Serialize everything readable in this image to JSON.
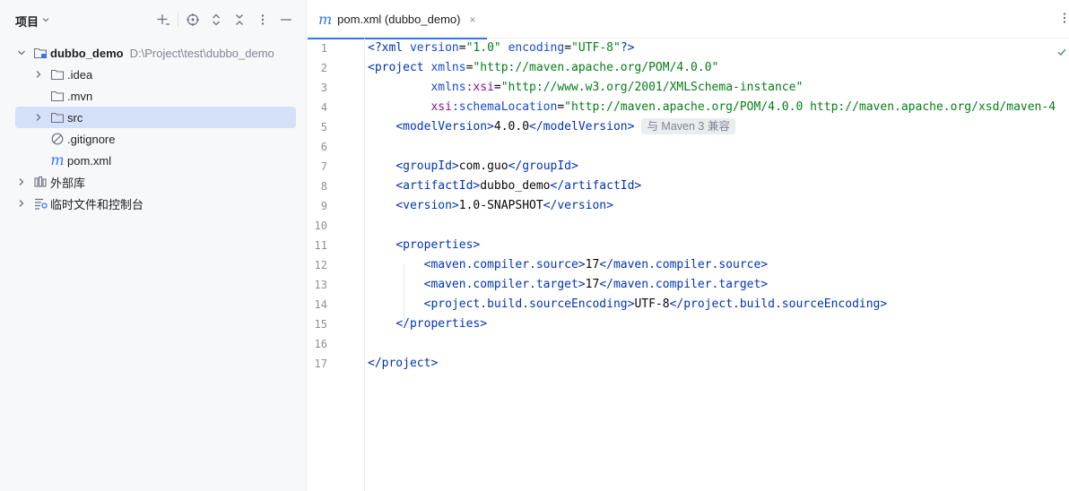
{
  "project_panel": {
    "title": "项目",
    "tools": [
      "add-icon",
      "locate-icon",
      "expand-all-icon",
      "collapse-all-icon",
      "more-icon",
      "hide-icon"
    ],
    "tree": {
      "root": {
        "label": "dubbo_demo",
        "path": "D:\\Project\\test\\dubbo_demo"
      },
      "idea": ".idea",
      "mvn": ".mvn",
      "src": "src",
      "gitignore": ".gitignore",
      "pom": "pom.xml",
      "ext_libs": "外部库",
      "scratches": "临时文件和控制台"
    }
  },
  "editor": {
    "tab": {
      "label": "pom.xml (dubbo_demo)",
      "icon_glyph": "m",
      "close": "×"
    },
    "line_numbers": [
      "1",
      "2",
      "3",
      "4",
      "5",
      "6",
      "7",
      "8",
      "9",
      "10",
      "11",
      "12",
      "13",
      "14",
      "15",
      "16",
      "17"
    ],
    "code": {
      "l1": {
        "decl": "<?xml",
        "a1": "version",
        "v1": "\"1.0\"",
        "a2": "encoding",
        "v2": "\"UTF-8\"",
        "end": "?>"
      },
      "l2": {
        "tag": "<project",
        "attr": "xmlns",
        "val": "\"http://maven.apache.org/POM/4.0.0\""
      },
      "l3": {
        "ns": "xmlns",
        "attr": ":xsi",
        "val": "\"http://www.w3.org/2001/XMLSchema-instance\""
      },
      "l4": {
        "ns": "xsi",
        "attr": ":schemaLocation",
        "val": "\"http://maven.apache.org/POM/4.0.0 http://maven.apache.org/xsd/maven-4"
      },
      "l5": {
        "open": "<modelVersion>",
        "text": "4.0.0",
        "close": "</modelVersion>",
        "hint": "与 Maven 3 兼容"
      },
      "l7": {
        "open": "<groupId>",
        "text": "com.guo",
        "close": "</groupId>"
      },
      "l8": {
        "open": "<artifactId>",
        "text": "dubbo_demo",
        "close": "</artifactId>"
      },
      "l9": {
        "open": "<version>",
        "text": "1.0-SNAPSHOT",
        "close": "</version>"
      },
      "l11": {
        "open": "<properties>"
      },
      "l12": {
        "open": "<maven.compiler.source>",
        "text": "17",
        "close": "</maven.compiler.source>"
      },
      "l13": {
        "open": "<maven.compiler.target>",
        "text": "17",
        "close": "</maven.compiler.target>"
      },
      "l14": {
        "open": "<project.build.sourceEncoding>",
        "text": "UTF-8",
        "close": "</project.build.sourceEncoding>"
      },
      "l15": {
        "close": "</properties>"
      },
      "l17": {
        "close": "</project>"
      }
    }
  },
  "colors": {
    "accent": "#3574f0",
    "selection": "#d5e1f8",
    "tag": "#0033b3",
    "string": "#067d17",
    "namespace": "#871094"
  }
}
